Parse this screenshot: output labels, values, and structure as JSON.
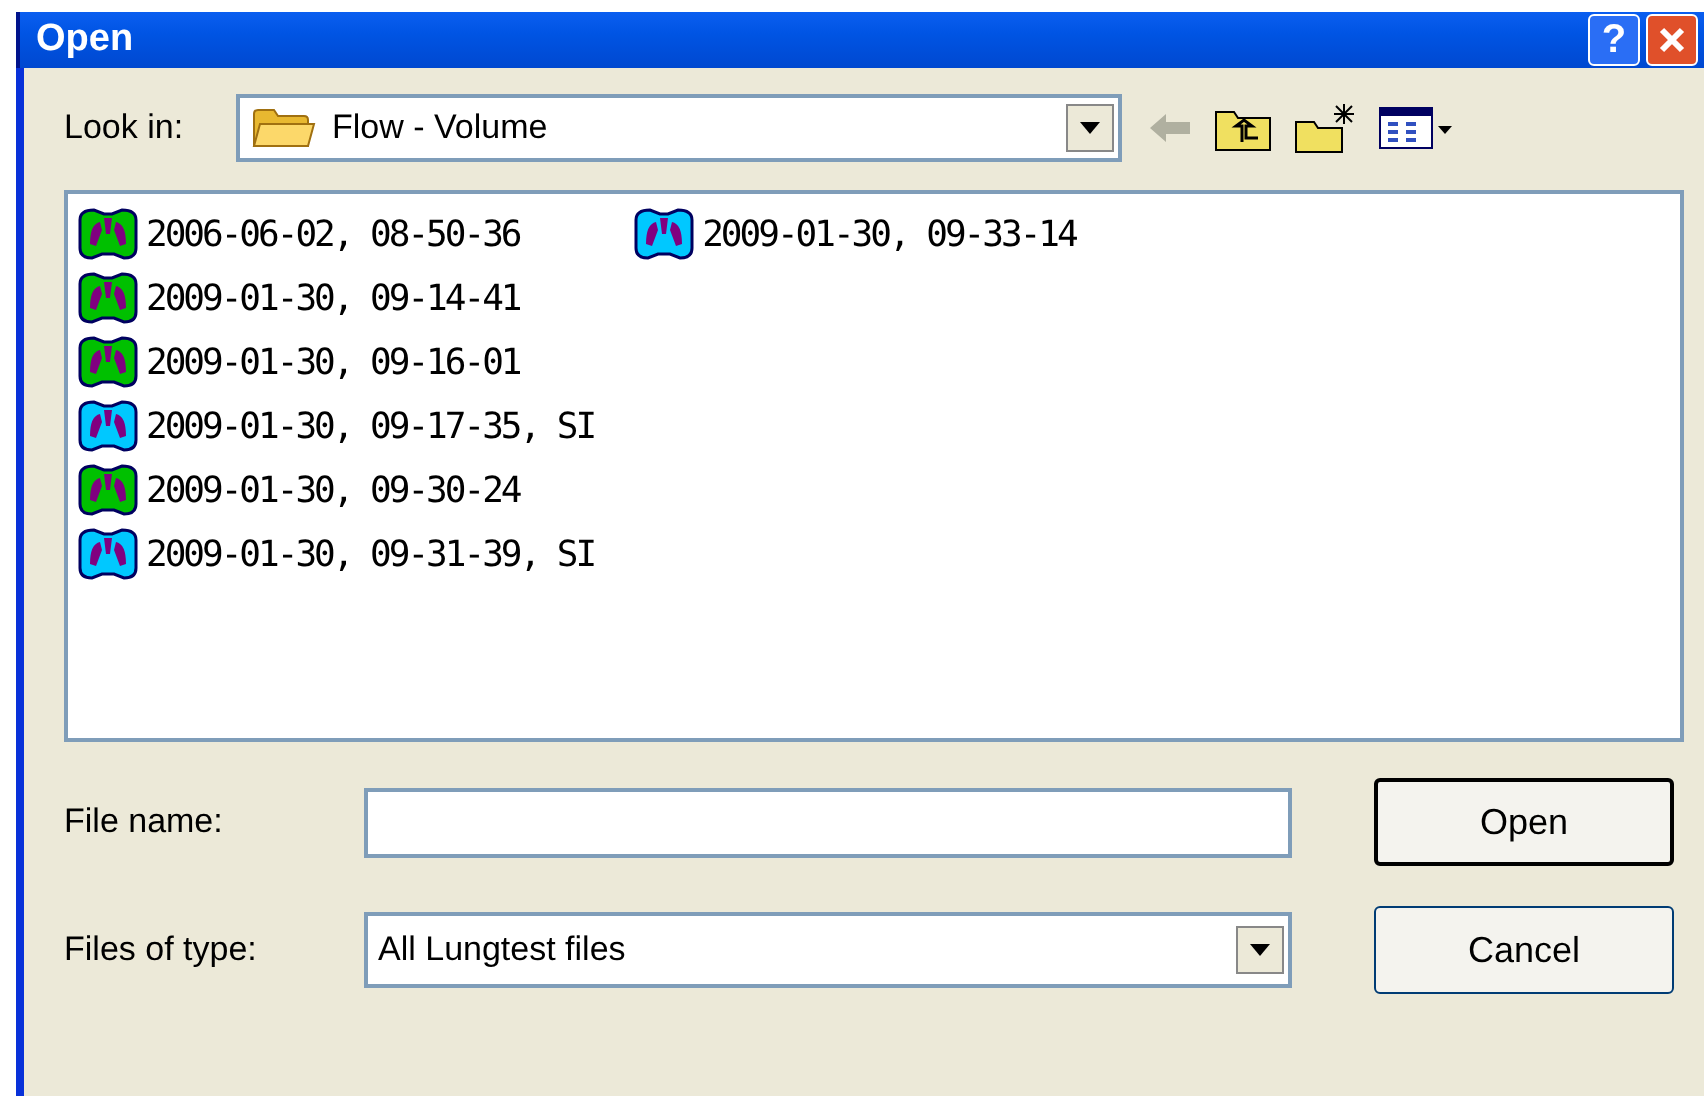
{
  "window": {
    "title": "Open",
    "buttons": [
      "?"
    ]
  },
  "look_in": {
    "label": "Look in:",
    "value": "Flow - Volume"
  },
  "files": [
    {
      "name": "2006-06-02, 08-50-36",
      "color": "#00c000"
    },
    {
      "name": "2009-01-30, 09-14-41",
      "color": "#00c000"
    },
    {
      "name": "2009-01-30, 09-16-01",
      "color": "#00c000"
    },
    {
      "name": "2009-01-30, 09-17-35, SI",
      "color": "#00c8ff"
    },
    {
      "name": "2009-01-30, 09-30-24",
      "color": "#00c000"
    },
    {
      "name": "2009-01-30, 09-31-39, SI",
      "color": "#00c8ff"
    },
    {
      "name": "2009-01-30, 09-33-14",
      "color": "#00c8ff"
    }
  ],
  "file_name": {
    "label": "File name:"
  },
  "file_type": {
    "label": "Files of type:",
    "value": "All Lungtest files"
  },
  "buttons": [
    {
      "label": "Open",
      "default": true
    },
    {
      "label": "Cancel",
      "default": false
    }
  ]
}
